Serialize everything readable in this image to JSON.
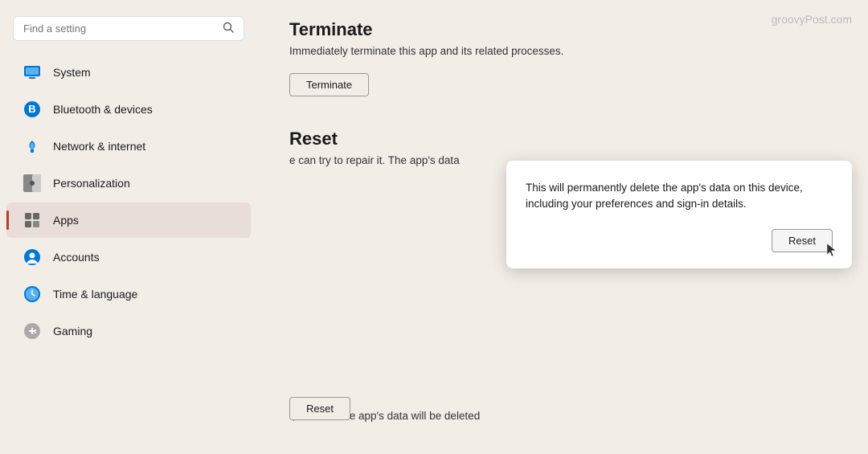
{
  "sidebar": {
    "search_placeholder": "Find a setting",
    "items": [
      {
        "id": "system",
        "label": "System",
        "icon": "system"
      },
      {
        "id": "bluetooth",
        "label": "Bluetooth & devices",
        "icon": "bluetooth"
      },
      {
        "id": "network",
        "label": "Network & internet",
        "icon": "network"
      },
      {
        "id": "personalization",
        "label": "Personalization",
        "icon": "personalization"
      },
      {
        "id": "apps",
        "label": "Apps",
        "icon": "apps",
        "active": true
      },
      {
        "id": "accounts",
        "label": "Accounts",
        "icon": "accounts"
      },
      {
        "id": "time",
        "label": "Time & language",
        "icon": "time"
      },
      {
        "id": "gaming",
        "label": "Gaming",
        "icon": "gaming"
      }
    ]
  },
  "main": {
    "watermark": "groovyPost.com",
    "terminate_section": {
      "title": "Terminate",
      "description": "Immediately terminate this app and its related processes.",
      "button_label": "Terminate"
    },
    "reset_section": {
      "title": "Reset",
      "description_partial": "e can try to repair it. The app's data",
      "description_bottom": "t, reset it. The app's data will be deleted",
      "button_label": "Reset"
    },
    "dialog": {
      "text": "This will permanently delete the app's data on this device, including your preferences and sign-in details.",
      "button_label": "Reset"
    }
  }
}
